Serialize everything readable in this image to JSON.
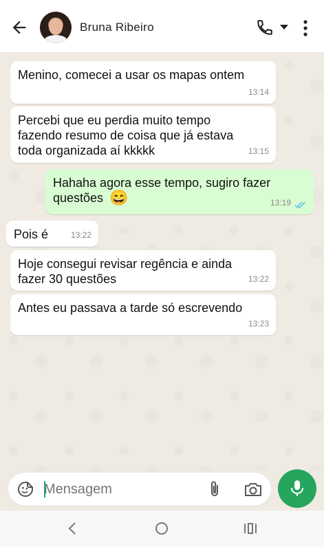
{
  "header": {
    "contact_name": "Bruna Ribeiro",
    "icons": [
      "back-arrow-icon",
      "call-icon",
      "caret-down-icon",
      "more-vert-icon"
    ]
  },
  "messages": [
    {
      "direction": "in",
      "text": "Menino, comecei a usar os mapas ontem",
      "time": "13:14"
    },
    {
      "direction": "in",
      "text": "Percebi que eu perdia muito tempo fazendo resumo de coisa que já estava toda organizada aí kkkkk",
      "time": "13:15"
    },
    {
      "direction": "out",
      "text": "Hahaha agora esse tempo, sugiro fazer questões",
      "emoji": "😄",
      "time": "13:19",
      "status": "read"
    },
    {
      "direction": "in",
      "text": "Pois é",
      "time": "13:22"
    },
    {
      "direction": "in",
      "text": "Hoje consegui revisar regência e ainda fazer 30 questões",
      "time": "13:22"
    },
    {
      "direction": "in",
      "text": "Antes eu passava a tarde só escrevendo",
      "time": "13:23"
    }
  ],
  "composer": {
    "placeholder": "Mensagem"
  },
  "colors": {
    "incoming_bubble": "#ffffff",
    "outgoing_bubble": "#d9fdd3",
    "accent": "#25a55d",
    "read_ticks": "#53bdeb",
    "chat_background": "#efeae2"
  }
}
